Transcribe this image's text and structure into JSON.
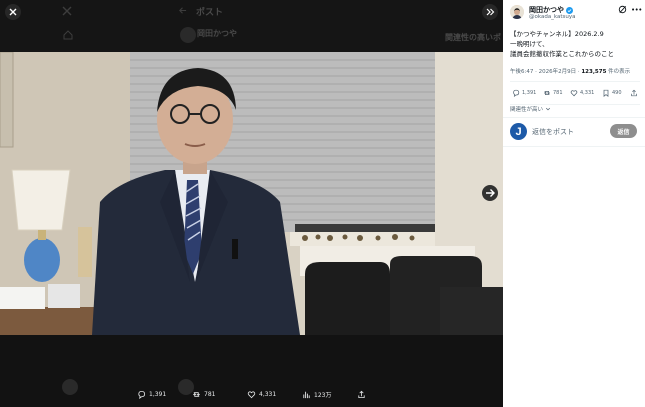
{
  "viewer": {
    "background_nav": {
      "post_label": "ポスト",
      "name_ghost": "岡田かつや",
      "trending_ghost": "関連性の高いポ"
    },
    "actions": [
      {
        "icon": "reply-icon",
        "count": "1,391"
      },
      {
        "icon": "repost-icon",
        "count": "781"
      },
      {
        "icon": "like-icon",
        "count": "4,331"
      },
      {
        "icon": "views-icon",
        "count": "123万"
      },
      {
        "icon": "share-icon",
        "count": ""
      }
    ]
  },
  "post": {
    "author_name": "岡田かつや",
    "handle": "@okada_katsuya",
    "body": [
      "【かつやチャンネル】2026.2.9",
      "一晩明けて、",
      "議員会館撤収作業とこれからのこと"
    ],
    "time": "午後6:47 · 2026年2月9日 · ",
    "views": "123,575",
    "views_suffix": " 件の表示",
    "counts": {
      "reply": "1,391",
      "repost": "781",
      "like": "4,331",
      "bookmark": "490"
    },
    "sort_label": "関連性が高い"
  },
  "reply": {
    "avatar_letter": "J",
    "placeholder": "返信をポスト",
    "button_label": "返信"
  },
  "colors": {
    "panel_bg": "#ffffff",
    "viewer_bg": "#0d0d0d",
    "reply_button": "#8e8e8e",
    "verified": "#1d9bf0",
    "reply_avatar": "#1d5aa8"
  }
}
